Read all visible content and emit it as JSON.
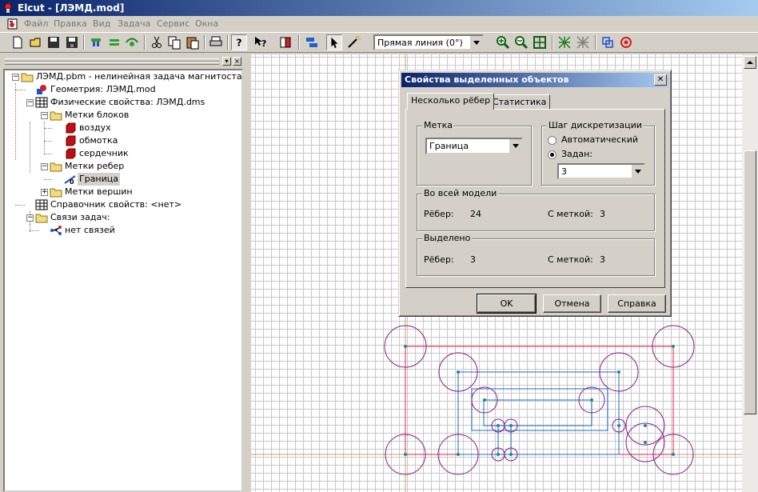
{
  "window": {
    "title": "Elcut - [ЛЭМД.mod]"
  },
  "menu": [
    "Файл",
    "Правка",
    "Вид",
    "Задача",
    "Сервис",
    "Окна"
  ],
  "toolbar": {
    "combo_value": "Прямая линия (0°)",
    "icons": [
      "new-icon",
      "open-icon",
      "save-icon",
      "save-all-icon",
      "magnet-icon",
      "equals-icon",
      "solve-icon",
      "cut-icon",
      "copy-icon",
      "paste-icon",
      "print-icon",
      "help-icon",
      "context-help-icon",
      "book-icon",
      "blocks-icon",
      "select-arrow-icon",
      "magic-icon",
      "zoom-in-icon",
      "zoom-out-icon",
      "zoom-fit-icon",
      "mesh-icon",
      "remove-mesh-icon",
      "copy-objects-icon",
      "record-icon"
    ]
  },
  "tree": [
    {
      "label": "ЛЭМД.pbm - нелинейная задача магнитостатики",
      "icon": "problem-folder-icon"
    },
    {
      "label": "Геометрия: ЛЭМД.mod",
      "icon": "geometry-icon"
    },
    {
      "label": "Физические свойства: ЛЭМД.dms",
      "icon": "grid-table-icon"
    },
    {
      "label": "Метки блоков",
      "icon": "folder-icon"
    },
    {
      "label": "воздух",
      "icon": "red-cube-icon"
    },
    {
      "label": "обмотка",
      "icon": "red-cube-icon"
    },
    {
      "label": "сердечник",
      "icon": "red-cube-icon"
    },
    {
      "label": "Метки ребер",
      "icon": "folder-icon"
    },
    {
      "label": "Граница",
      "icon": "edge-label-icon"
    },
    {
      "label": "Метки вершин",
      "icon": "folder-icon"
    },
    {
      "label": "Справочник свойств: <нет>",
      "icon": "grid-table-icon"
    },
    {
      "label": "Связи задач:",
      "icon": "folder-icon"
    },
    {
      "label": "нет связей",
      "icon": "links-icon"
    }
  ],
  "dialog": {
    "title": "Свойства выделенных объектов",
    "tabs": [
      "Несколько рёбер",
      "Статистика"
    ],
    "label_group": {
      "title": "Метка",
      "value": "Граница"
    },
    "step_group": {
      "title": "Шаг дискретизации",
      "auto_label": "Автоматический",
      "set_label": "Задан:",
      "set_value": "3",
      "selected": "set"
    },
    "whole_model": {
      "title": "Во всей модели",
      "edges_label": "Рёбер:",
      "edges_value": "24",
      "labeled_label": "С меткой:",
      "labeled_value": "3"
    },
    "selected": {
      "title": "Выделено",
      "edges_label": "Рёбер:",
      "edges_value": "3",
      "labeled_label": "С меткой:",
      "labeled_value": "3"
    },
    "buttons": {
      "ok": "OK",
      "cancel": "Отмена",
      "help": "Справка"
    }
  },
  "colors": {
    "title_start": "#0a246a",
    "title_end": "#a6caf0",
    "boundary": "#e8203a",
    "edge": "#1a6ec8",
    "circle": "#8a1a8a",
    "node": "#1a8a9a",
    "axis": "#c8a060"
  }
}
